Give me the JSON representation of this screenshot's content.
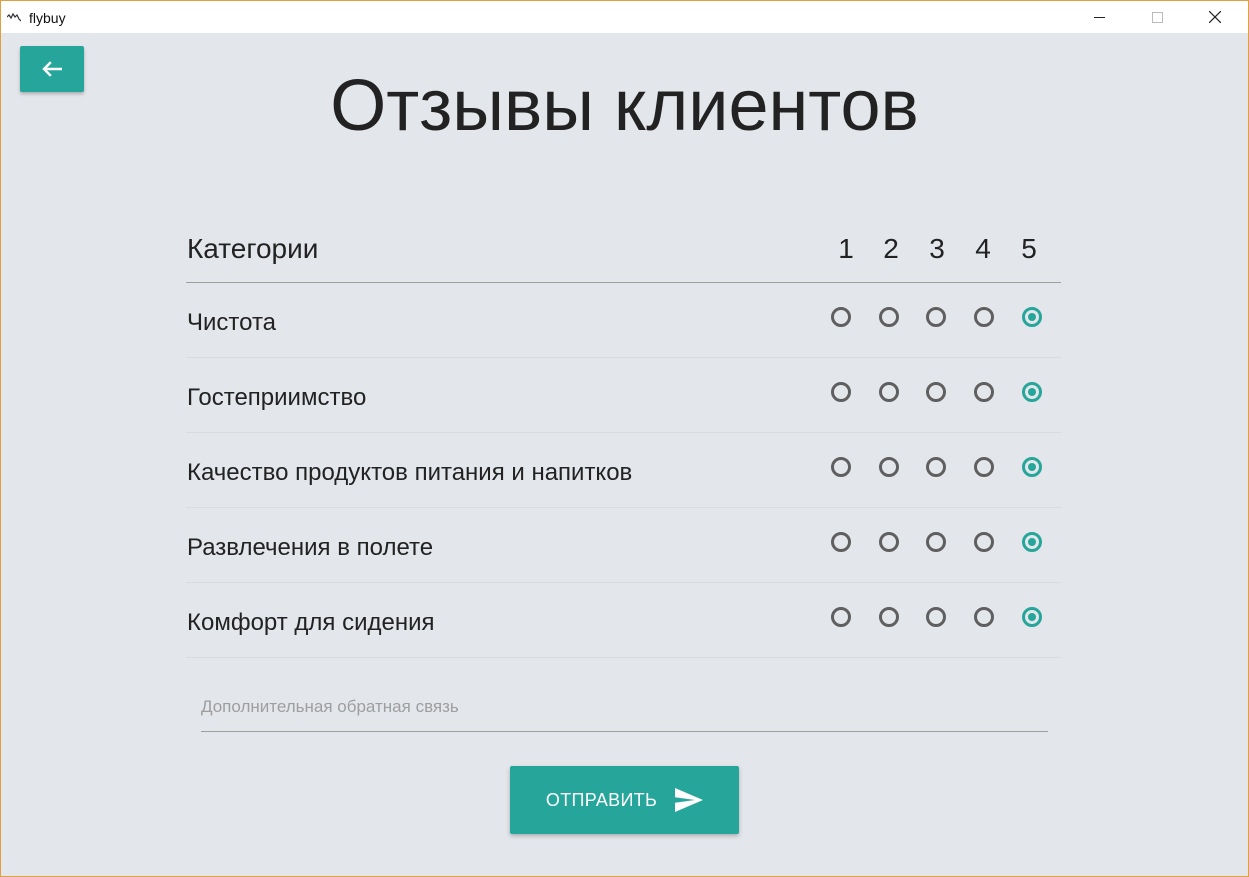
{
  "window": {
    "app_title": "flybuy"
  },
  "page": {
    "title": "Отзывы клиентов"
  },
  "table": {
    "header_label": "Категории",
    "scale": [
      "1",
      "2",
      "3",
      "4",
      "5"
    ],
    "rows": [
      {
        "label": "Чистота",
        "selected": 5
      },
      {
        "label": "Гостеприимство",
        "selected": 5
      },
      {
        "label": "Качество продуктов питания и напитков",
        "selected": 5
      },
      {
        "label": "Развлечения в полете",
        "selected": 5
      },
      {
        "label": "Комфорт для сидения",
        "selected": 5
      }
    ]
  },
  "feedback": {
    "placeholder": "Дополнительная обратная связь",
    "value": ""
  },
  "submit": {
    "label": "ОТПРАВИТЬ"
  },
  "colors": {
    "accent": "#26a69a",
    "background": "#e3e6eb"
  },
  "icons": {
    "back": "arrow-left-icon",
    "send": "send-icon"
  }
}
